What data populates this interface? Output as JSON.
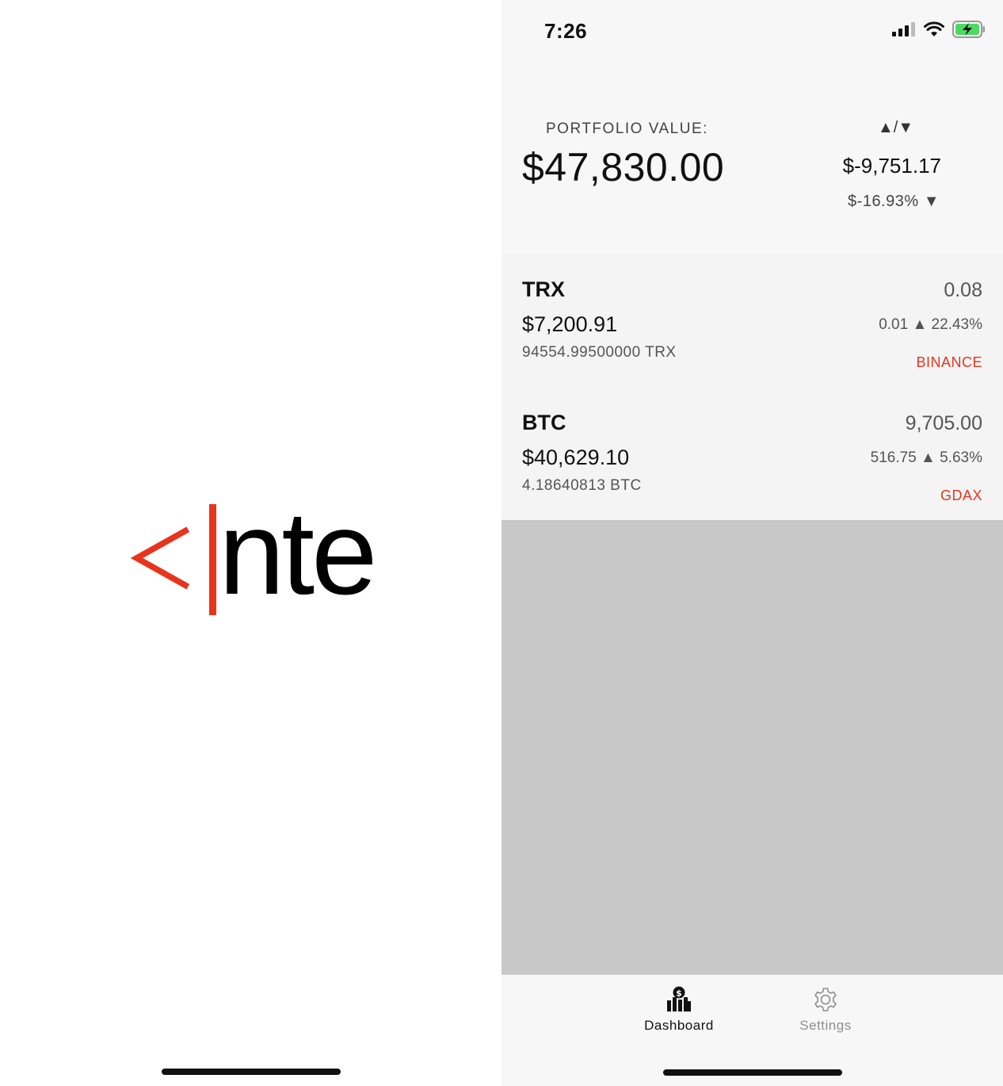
{
  "splash": {
    "logo_text": "nte",
    "accent_color": "#e8341c"
  },
  "status_bar": {
    "time": "7:26",
    "icons": [
      "signal-icon",
      "wifi-icon",
      "battery-charging-icon"
    ]
  },
  "portfolio": {
    "label": "PORTFOLIO VALUE:",
    "value": "$47,830.00",
    "change_header": "▲/▼",
    "change_amount": "$-9,751.17",
    "change_percent": "$-16.93% ▼"
  },
  "coins": [
    {
      "symbol": "TRX",
      "value": "$7,200.91",
      "holdings": "94554.99500000 TRX",
      "price": "0.08",
      "change": "0.01 ▲ 22.43%",
      "exchange": "BINANCE"
    },
    {
      "symbol": "BTC",
      "value": "$40,629.10",
      "holdings": "4.18640813 BTC",
      "price": "9,705.00",
      "change": "516.75 ▲ 5.63%",
      "exchange": "GDAX"
    }
  ],
  "tabs": [
    {
      "label": "Dashboard",
      "icon": "dashboard-icon",
      "active": true
    },
    {
      "label": "Settings",
      "icon": "gear-icon",
      "active": false
    }
  ]
}
